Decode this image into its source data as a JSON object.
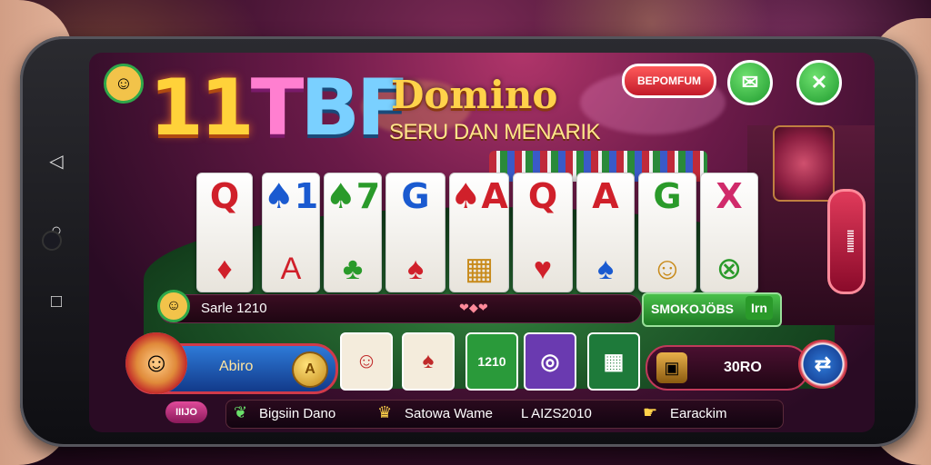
{
  "header": {
    "logo_text_1": "11",
    "logo_text_2": "T",
    "logo_text_3": "BF",
    "title": "Domino",
    "subtitle": "SERU DAN MENARIK",
    "top_button_label": "BEPOMFUM",
    "chat_icon": "chat-icon",
    "close_icon": "close-icon"
  },
  "cards": [
    {
      "top": "Q",
      "bottom": "♦",
      "top_color": "#d0202a",
      "bot_color": "#d0202a"
    },
    {
      "top": "♠1",
      "bottom": "A",
      "top_color": "#1a5ad0",
      "bot_color": "#d0202a"
    },
    {
      "top": "♠7",
      "bottom": "♣",
      "top_color": "#2a9a2a",
      "bot_color": "#2a9a2a"
    },
    {
      "top": "G",
      "bottom": "♠",
      "top_color": "#1a5ad0",
      "bot_color": "#d0202a"
    },
    {
      "top": "♠A",
      "bottom": "▦",
      "top_color": "#d0202a",
      "bot_color": "#c88a1a"
    },
    {
      "top": "Q",
      "bottom": "♥",
      "top_color": "#d0202a",
      "bot_color": "#d0202a"
    },
    {
      "top": "A",
      "bottom": "♠",
      "top_color": "#d0202a",
      "bot_color": "#1a5ad0"
    },
    {
      "top": "G",
      "bottom": "☺",
      "top_color": "#2a9a2a",
      "bot_color": "#c88a1a"
    },
    {
      "top": "X",
      "bottom": "⊗",
      "top_color": "#d02a6a",
      "bot_color": "#2a9a2a"
    }
  ],
  "info_bar": {
    "player_label": "Sarle 1210",
    "right_label": "SMOKOJÖBS",
    "right_suffix": "Irn"
  },
  "bottom_controls": {
    "balance_label": "Abiro",
    "coin_symbol": "A",
    "tile_1": "☺",
    "tile_2": "♠",
    "tile_3": "1210",
    "tile_4": "◎",
    "tile_5": "▦",
    "score_label": "30RO",
    "refresh_icon": "swap-icon"
  },
  "bottom_strip": {
    "pill": "IIIJO",
    "item_1": "Bigsiin Dano",
    "item_2": "Satowa Wame",
    "item_3": "L AIZS2010",
    "item_4": "Earackim"
  },
  "side_pill": "IIIIIIIII"
}
